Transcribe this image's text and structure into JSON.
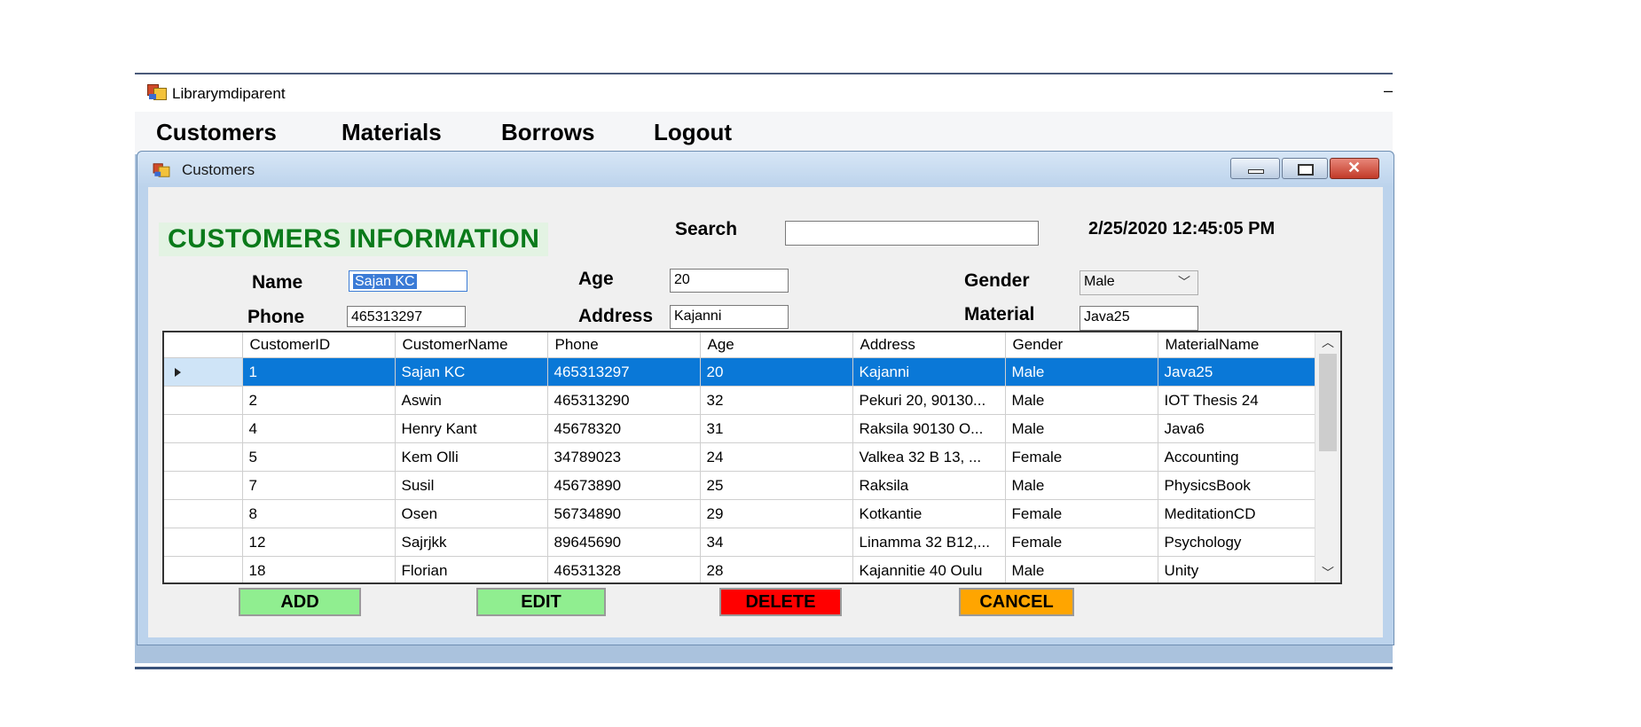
{
  "app": {
    "title": "Librarymdiparent",
    "minimize_glyph": "–"
  },
  "menu": [
    {
      "label": "Customers"
    },
    {
      "label": "Materials"
    },
    {
      "label": "Borrows"
    },
    {
      "label": "Logout"
    }
  ],
  "child": {
    "title": "Customers",
    "controls": [
      "minimize",
      "restore",
      "close"
    ]
  },
  "form": {
    "heading": "CUSTOMERS INFORMATION",
    "search_label": "Search",
    "search_value": "",
    "datetime": "2/25/2020 12:45:05 PM",
    "name_label": "Name",
    "name_value": "Sajan KC",
    "phone_label": "Phone",
    "phone_value": "465313297",
    "age_label": "Age",
    "age_value": "20",
    "address_label": "Address",
    "address_value": "Kajanni",
    "gender_label": "Gender",
    "gender_value": "Male",
    "material_label": "Material",
    "material_value": "Java25"
  },
  "grid": {
    "columns": [
      "CustomerID",
      "CustomerName",
      "Phone",
      "Age",
      "Address",
      "Gender",
      "MaterialName"
    ],
    "selected_row": 0,
    "rows": [
      [
        "1",
        "Sajan KC",
        "465313297",
        "20",
        "Kajanni",
        "Male",
        "Java25"
      ],
      [
        "2",
        "Aswin",
        "465313290",
        "32",
        "Pekuri 20, 90130...",
        "Male",
        "IOT Thesis 24"
      ],
      [
        "4",
        "Henry Kant",
        "45678320",
        "31",
        "Raksila 90130 O...",
        "Male",
        "Java6"
      ],
      [
        "5",
        "Kem Olli",
        "34789023",
        "24",
        "Valkea 32 B 13, ...",
        "Female",
        "Accounting"
      ],
      [
        "7",
        "Susil",
        "45673890",
        "25",
        "Raksila",
        "Male",
        "PhysicsBook"
      ],
      [
        "8",
        "Osen",
        "56734890",
        "29",
        "Kotkantie",
        "Female",
        "MeditationCD"
      ],
      [
        "12",
        "Sajrjkk",
        "89645690",
        "34",
        "Linamma 32 B12,...",
        "Female",
        "Psychology"
      ],
      [
        "18",
        "Florian",
        "46531328",
        "28",
        "Kajannitie 40 Oulu",
        "Male",
        "Unity"
      ]
    ]
  },
  "buttons": {
    "add": "ADD",
    "edit": "EDIT",
    "delete": "DELETE",
    "cancel": "CANCEL"
  },
  "colors": {
    "heading_green": "#0a7a1a",
    "add_bg": "#90ee90",
    "edit_bg": "#90ee90",
    "delete_bg": "#ff0000",
    "cancel_bg": "#ffa500",
    "selection_blue": "#0a78d7"
  }
}
